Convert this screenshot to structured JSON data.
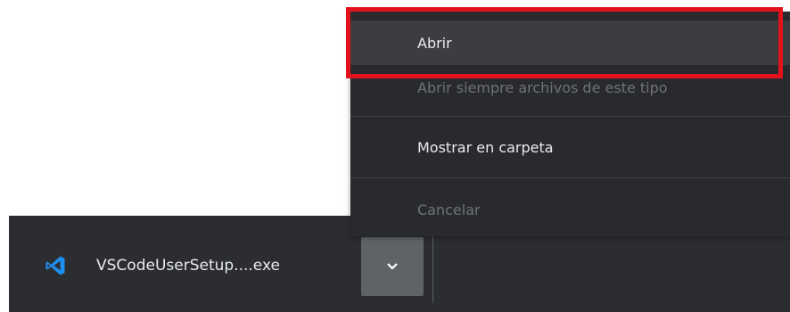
{
  "download_bar": {
    "file_name": "VSCodeUserSetup....exe",
    "file_icon": "vscode-icon",
    "menu_button_icon": "chevron-down-icon"
  },
  "context_menu": {
    "items": [
      {
        "label": "Abrir",
        "disabled": false,
        "hovered": true
      },
      {
        "label": "Abrir siempre archivos de este tipo",
        "disabled": true,
        "hovered": false
      },
      {
        "label": "Mostrar en carpeta",
        "disabled": false,
        "hovered": false
      },
      {
        "label": "Cancelar",
        "disabled": true,
        "hovered": false
      }
    ]
  },
  "colors": {
    "highlight": "#e2121d",
    "vscode_blue": "#1e8ef0",
    "bar_background": "#2b2d30",
    "menu_background": "#292a2d"
  }
}
